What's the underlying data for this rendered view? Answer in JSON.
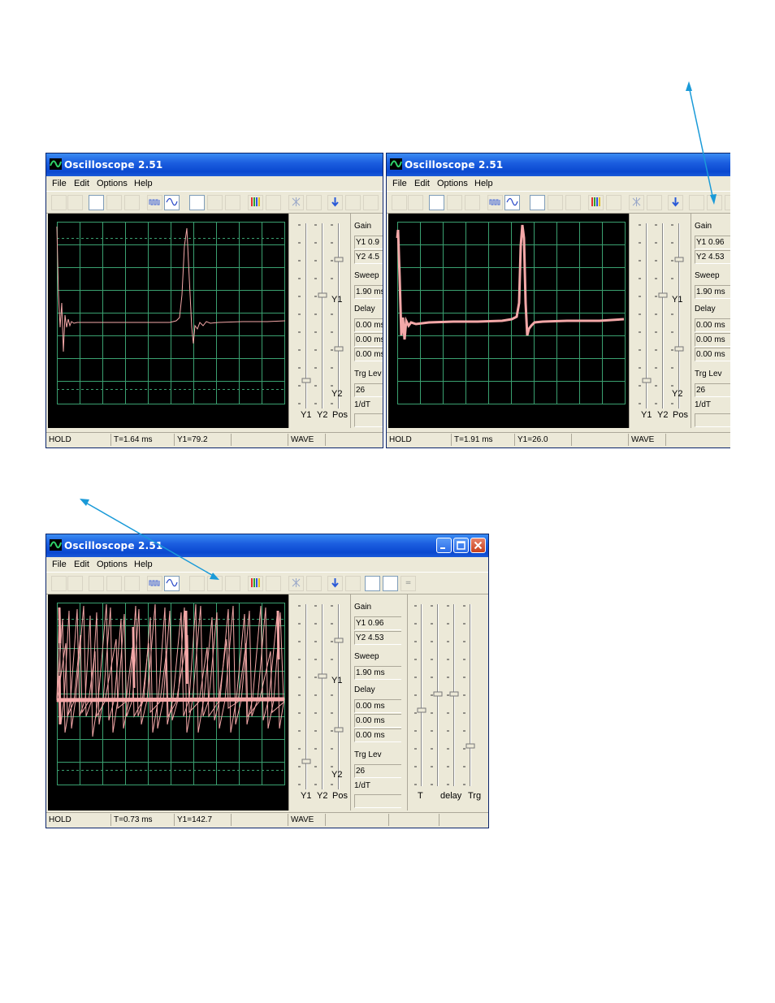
{
  "app_title": "Oscilloscope 2.51",
  "menu": [
    "File",
    "Edit",
    "Options",
    "Help"
  ],
  "panel": {
    "gain_label": "Gain",
    "sweep_label": "Sweep",
    "delay_label": "Delay",
    "trg_label": "Trg Lev",
    "inv_dt_label": "1/dT",
    "sweep_value": "1.90 ms",
    "delay_values": [
      "0.00 ms",
      "0.00 ms",
      "0.00 ms"
    ],
    "trg_value": "26"
  },
  "slider_labels": {
    "y1": "Y1",
    "y2": "Y2",
    "pos": "Pos",
    "t": "T",
    "delay": "delay",
    "trg": "Trg"
  },
  "windows": [
    {
      "gain_y1": "Y1 0.9",
      "gain_y2": "Y2 4.5",
      "status": {
        "mode": "HOLD",
        "t": "T=1.64 ms",
        "y1": "Y1=79.2",
        "wave": "WAVE"
      }
    },
    {
      "gain_y1": "Y1 0.96",
      "gain_y2": "Y2 4.53",
      "status": {
        "mode": "HOLD",
        "t": "T=1.91 ms",
        "y1": "Y1=26.0",
        "wave": "WAVE"
      }
    },
    {
      "gain_y1": "Y1 0.96",
      "gain_y2": "Y2 4.53",
      "status": {
        "mode": "HOLD",
        "t": "T=0.73 ms",
        "y1": "Y1=142.7",
        "wave": "WAVE"
      },
      "toolbar_extra": "="
    }
  ],
  "colors": {
    "trace": "#f4a8a8",
    "grid": "#3aa070",
    "arrow": "#1a9ad8"
  }
}
